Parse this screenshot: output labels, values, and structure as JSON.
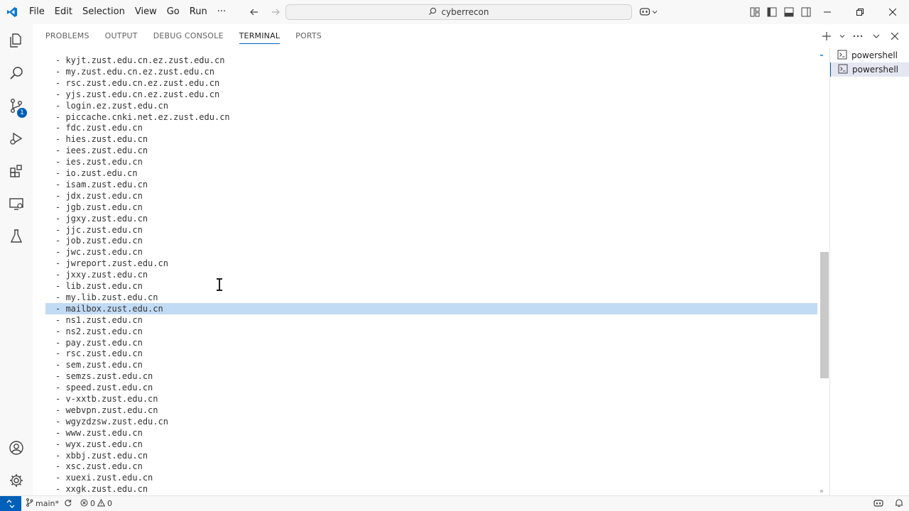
{
  "menu": [
    "File",
    "Edit",
    "Selection",
    "View",
    "Go",
    "Run",
    "···"
  ],
  "command_center": {
    "text": "cyberrecon"
  },
  "activity_bar": {
    "source_control_badge": "1"
  },
  "panel": {
    "tabs": [
      "PROBLEMS",
      "OUTPUT",
      "DEBUG CONSOLE",
      "TERMINAL",
      "PORTS"
    ],
    "active_tab": "TERMINAL"
  },
  "terminal": {
    "selected_index": 22,
    "lines": [
      "- kyjt.zust.edu.cn.ez.zust.edu.cn",
      "- my.zust.edu.cn.ez.zust.edu.cn",
      "- rsc.zust.edu.cn.ez.zust.edu.cn",
      "- yjs.zust.edu.cn.ez.zust.edu.cn",
      "- login.ez.zust.edu.cn",
      "- piccache.cnki.net.ez.zust.edu.cn",
      "- fdc.zust.edu.cn",
      "- hies.zust.edu.cn",
      "- iees.zust.edu.cn",
      "- ies.zust.edu.cn",
      "- io.zust.edu.cn",
      "- isam.zust.edu.cn",
      "- jdx.zust.edu.cn",
      "- jgb.zust.edu.cn",
      "- jgxy.zust.edu.cn",
      "- jjc.zust.edu.cn",
      "- job.zust.edu.cn",
      "- jwc.zust.edu.cn",
      "- jwreport.zust.edu.cn",
      "- jxxy.zust.edu.cn",
      "- lib.zust.edu.cn",
      "- my.lib.zust.edu.cn",
      "- mailbox.zust.edu.cn",
      "- ns1.zust.edu.cn",
      "- ns2.zust.edu.cn",
      "- pay.zust.edu.cn",
      "- rsc.zust.edu.cn",
      "- sem.zust.edu.cn",
      "- semzs.zust.edu.cn",
      "- speed.zust.edu.cn",
      "- v-xxtb.zust.edu.cn",
      "- webvpn.zust.edu.cn",
      "- wgyzdzsw.zust.edu.cn",
      "- www.zust.edu.cn",
      "- wyx.zust.edu.cn",
      "- xbbj.zust.edu.cn",
      "- xsc.zust.edu.cn",
      "- xuexi.zust.edu.cn",
      "- xxgk.zust.edu.cn"
    ]
  },
  "terminal_list": [
    {
      "label": "powershell",
      "active": false
    },
    {
      "label": "powershell",
      "active": true
    }
  ],
  "status_bar": {
    "branch": "main*",
    "errors": "0",
    "warnings": "0"
  },
  "colors": {
    "accent": "#005fb8",
    "selection": "#c2dbf5"
  }
}
